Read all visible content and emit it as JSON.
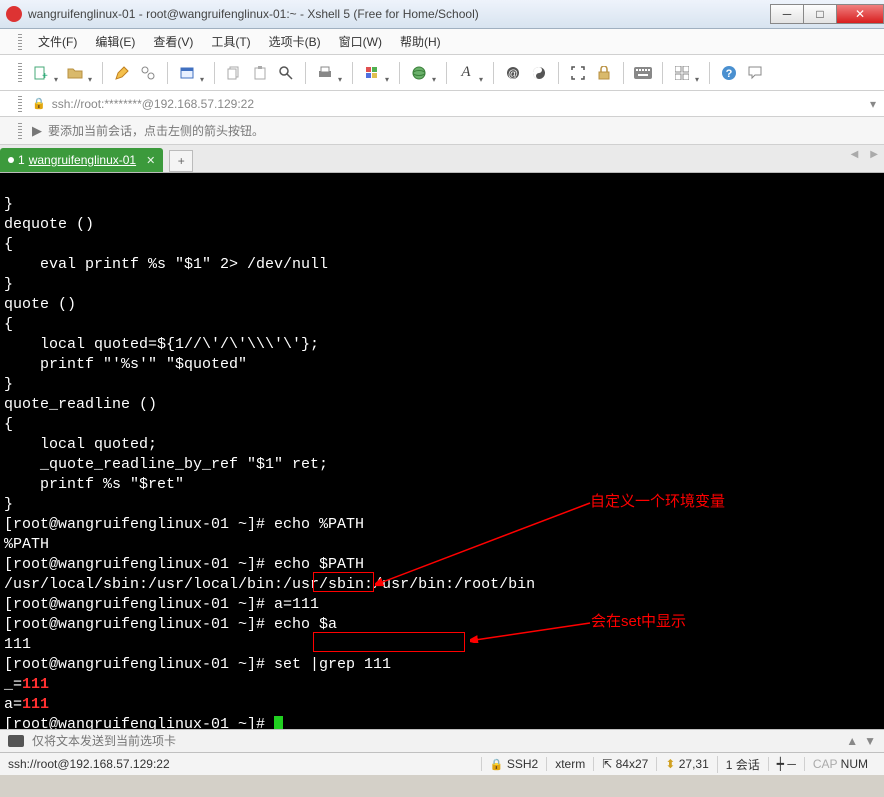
{
  "window": {
    "title": "wangruifenglinux-01 - root@wangruifenglinux-01:~ - Xshell 5 (Free for Home/School)"
  },
  "menu": {
    "file": "文件(F)",
    "edit": "编辑(E)",
    "view": "查看(V)",
    "tools": "工具(T)",
    "tab": "选项卡(B)",
    "window": "窗口(W)",
    "help": "帮助(H)"
  },
  "address": {
    "text": "ssh://root:********@192.168.57.129:22"
  },
  "infobar": {
    "text": "要添加当前会话，点击左侧的箭头按钮。"
  },
  "tab": {
    "index": "1",
    "label": "wangruifenglinux-01",
    "new": "+"
  },
  "terminal": {
    "lines": [
      "}",
      "dequote ()",
      "{",
      "    eval printf %s \"$1\" 2> /dev/null",
      "}",
      "quote ()",
      "{",
      "    local quoted=${1//\\'/\\'\\\\\\'\\'};",
      "    printf \"'%s'\" \"$quoted\"",
      "}",
      "quote_readline ()",
      "{",
      "    local quoted;",
      "    _quote_readline_by_ref \"$1\" ret;",
      "    printf %s \"$ret\"",
      "}",
      "[root@wangruifenglinux-01 ~]# echo %PATH",
      "%PATH",
      "[root@wangruifenglinux-01 ~]# echo $PATH",
      "/usr/local/sbin:/usr/local/bin:/usr/sbin:/usr/bin:/root/bin",
      "[root@wangruifenglinux-01 ~]# a=111",
      "[root@wangruifenglinux-01 ~]# echo $a",
      "111",
      "[root@wangruifenglinux-01 ~]# set |grep 111"
    ],
    "result1_pre": "_=",
    "result1_val": "111",
    "result2_pre": "a=",
    "result2_val": "111",
    "prompt_last": "[root@wangruifenglinux-01 ~]# ",
    "annot1": "自定义一个环境变量",
    "annot2": "会在set中显示"
  },
  "bottominput": {
    "placeholder": "仅将文本发送到当前选项卡"
  },
  "status": {
    "left": "ssh://root@192.168.57.129:22",
    "ssh": "SSH2",
    "term": "xterm",
    "size": "84x27",
    "pos": "27,31",
    "sess": "1 会话",
    "cap": "CAP",
    "num": "NUM"
  }
}
